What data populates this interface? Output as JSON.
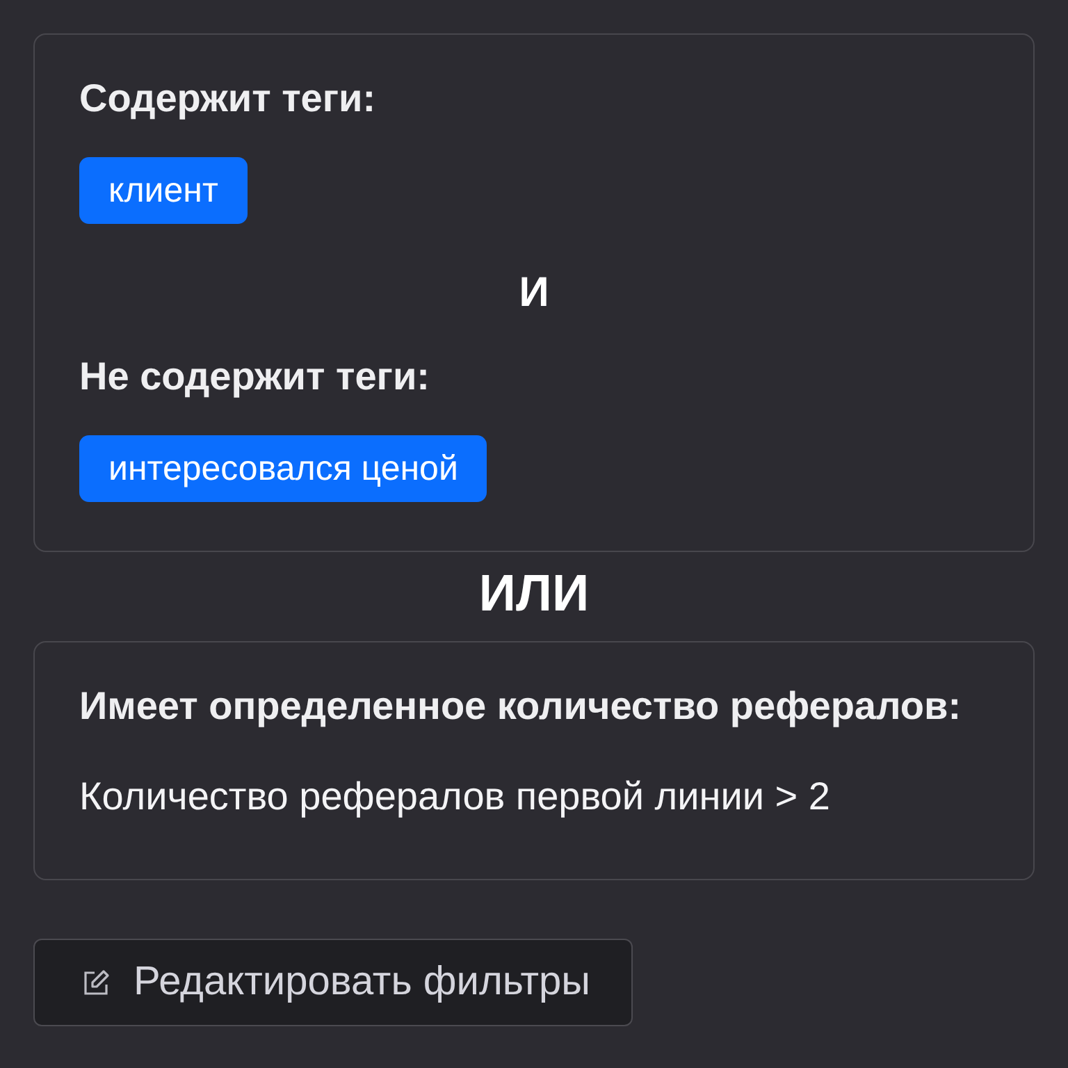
{
  "blocks": [
    {
      "kind": "card",
      "items": [
        {
          "kind": "tags",
          "title": "Содержит теги:",
          "tags": [
            "клиент"
          ]
        },
        {
          "kind": "joiner",
          "label": "И"
        },
        {
          "kind": "tags",
          "title": "Не содержит теги:",
          "tags": [
            "интересовался ценой"
          ]
        }
      ]
    },
    {
      "kind": "joiner",
      "label": "ИЛИ"
    },
    {
      "kind": "card",
      "items": [
        {
          "kind": "text",
          "title": "Имеет определенное количество рефералов:",
          "text": "Количество рефералов первой линии > 2"
        }
      ]
    }
  ],
  "edit_button": {
    "label": "Редактировать фильтры"
  }
}
